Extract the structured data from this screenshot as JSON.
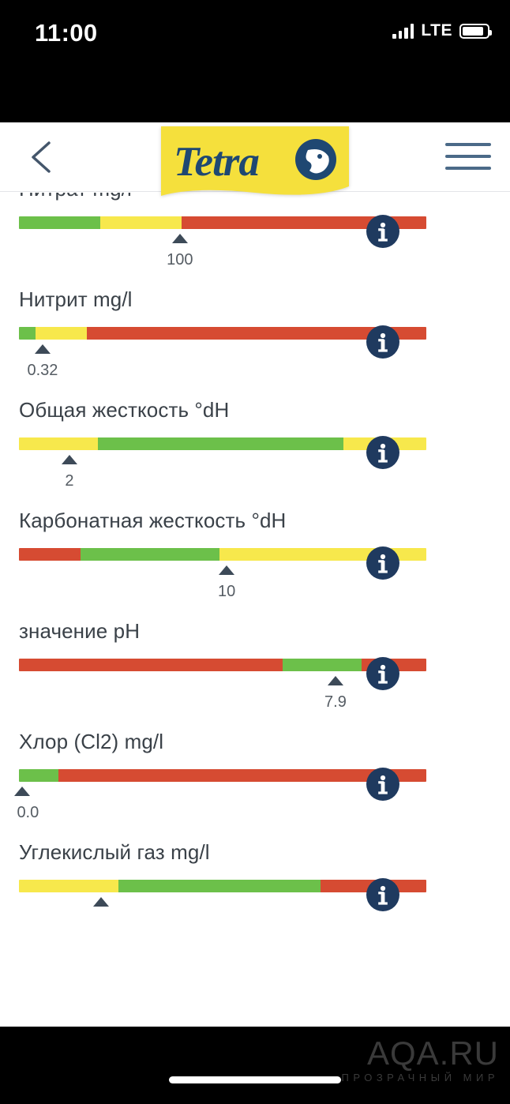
{
  "status_bar": {
    "time": "11:00",
    "network_label": "LTE",
    "signal_icon": "signal-bars-icon",
    "battery_icon": "battery-icon"
  },
  "app_bar": {
    "back_icon": "chevron-left-icon",
    "menu_icon": "hamburger-menu-icon",
    "logo_text": "Tetra",
    "logo_icon": "tetra-fish-logo",
    "logo_bg": "#F5E03C",
    "logo_fg": "#1F4872"
  },
  "colors": {
    "green": "#6CC04A",
    "yellow": "#F7E84C",
    "red": "#D64B32",
    "marker": "#3D4A58",
    "info_bg": "#1F3A5F",
    "text": "#3A4148"
  },
  "measurements": [
    {
      "label": "Нитрат mg/l",
      "value": "100",
      "marker_pct": 39.5,
      "info_icon": "info-icon",
      "segments": [
        {
          "color": "#6CC04A",
          "pct": 20
        },
        {
          "color": "#F7E84C",
          "pct": 20
        },
        {
          "color": "#D64B32",
          "pct": 60
        }
      ]
    },
    {
      "label": "Нитрит mg/l",
      "value": "0.32",
      "marker_pct": 5.8,
      "info_icon": "info-icon",
      "segments": [
        {
          "color": "#6CC04A",
          "pct": 4.1
        },
        {
          "color": "#F7E84C",
          "pct": 12.6
        },
        {
          "color": "#D64B32",
          "pct": 83.3
        }
      ]
    },
    {
      "label": "Общая жесткость °dH",
      "value": "2",
      "marker_pct": 12.4,
      "info_icon": "info-icon",
      "segments": [
        {
          "color": "#F7E84C",
          "pct": 19.4
        },
        {
          "color": "#6CC04A",
          "pct": 60.3
        },
        {
          "color": "#F7E84C",
          "pct": 20.3
        }
      ]
    },
    {
      "label": "Карбонатная жесткость °dH",
      "value": "10",
      "marker_pct": 51.0,
      "info_icon": "info-icon",
      "segments": [
        {
          "color": "#D64B32",
          "pct": 15.1
        },
        {
          "color": "#6CC04A",
          "pct": 34.1
        },
        {
          "color": "#F7E84C",
          "pct": 50.8
        }
      ]
    },
    {
      "label": "значение pH",
      "value": "7.9",
      "marker_pct": 77.7,
      "info_icon": "info-icon",
      "segments": [
        {
          "color": "#D64B32",
          "pct": 64.7
        },
        {
          "color": "#6CC04A",
          "pct": 19.4
        },
        {
          "color": "#D64B32",
          "pct": 15.9
        }
      ]
    },
    {
      "label": "Хлор (Cl2) mg/l",
      "value": "0.0",
      "marker_pct": 0.8,
      "info_icon": "info-icon",
      "segments": [
        {
          "color": "#6CC04A",
          "pct": 9.7
        },
        {
          "color": "#D64B32",
          "pct": 90.3
        }
      ]
    },
    {
      "label": "Углекислый газ mg/l",
      "value": "",
      "marker_pct": 20.2,
      "info_icon": "info-icon",
      "segments": [
        {
          "color": "#F7E84C",
          "pct": 24.4
        },
        {
          "color": "#6CC04A",
          "pct": 49.6
        },
        {
          "color": "#D64B32",
          "pct": 26.0
        }
      ]
    }
  ],
  "watermark": {
    "main": "AQA.RU",
    "sub": "ПРОЗРАЧНЫЙ МИР"
  }
}
